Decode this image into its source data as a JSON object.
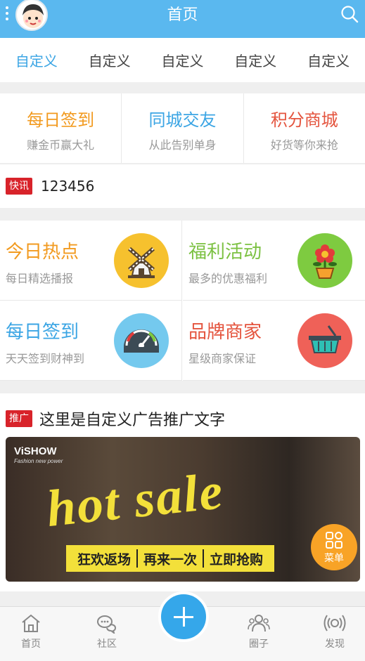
{
  "header": {
    "title": "首页"
  },
  "tabs": [
    {
      "label": "自定义"
    },
    {
      "label": "自定义"
    },
    {
      "label": "自定义"
    },
    {
      "label": "自定义"
    },
    {
      "label": "自定义"
    }
  ],
  "features": [
    {
      "title": "每日签到",
      "subtitle": "赚金币赢大礼",
      "color": "#f29a1f"
    },
    {
      "title": "同城交友",
      "subtitle": "从此告别单身",
      "color": "#3ba5e4"
    },
    {
      "title": "积分商城",
      "subtitle": "好货等你来抢",
      "color": "#e4543e"
    }
  ],
  "news": {
    "badge": "快讯",
    "text": "123456"
  },
  "grid": [
    {
      "title": "今日热点",
      "subtitle": "每日精选播报",
      "color": "#f29a1f",
      "icon": "windmill-icon",
      "icon_bg": "#f6c12e"
    },
    {
      "title": "福利活动",
      "subtitle": "最多的优惠福利",
      "color": "#7cc142",
      "icon": "flower-icon",
      "icon_bg": "#7ecb40"
    },
    {
      "title": "每日签到",
      "subtitle": "天天签到财神到",
      "color": "#3ba5e4",
      "icon": "gauge-icon",
      "icon_bg": "#74c9ee"
    },
    {
      "title": "品牌商家",
      "subtitle": "星级商家保证",
      "color": "#e4543e",
      "icon": "basket-icon",
      "icon_bg": "#ef6158"
    }
  ],
  "promo": {
    "badge": "推广",
    "text": "这里是自定义广告推广文字",
    "banner": {
      "brand": "ViSHOW",
      "brand_sub": "Fashion new power",
      "headline": "hot sale",
      "strip": [
        "狂欢返场",
        "再来一次",
        "立即抢购"
      ]
    },
    "menu_label": "菜单"
  },
  "bottom_nav": [
    {
      "label": "首页",
      "icon": "home-icon"
    },
    {
      "label": "社区",
      "icon": "chat-icon"
    },
    {
      "label": "圈子",
      "icon": "group-icon"
    },
    {
      "label": "发现",
      "icon": "discover-icon"
    }
  ]
}
